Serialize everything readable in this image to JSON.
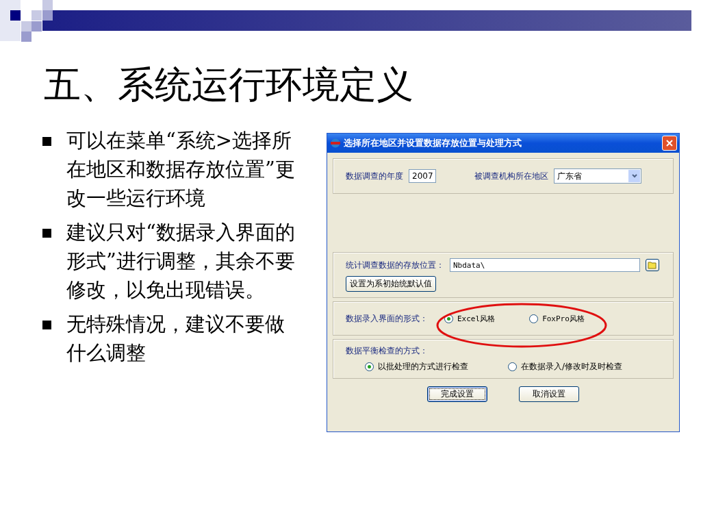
{
  "title": "五、系统运行环境定义",
  "bullets": [
    "可以在菜单“系统>选择所在地区和数据存放位置”更改一些运行环境",
    "建议只对“数据录入界面的形式”进行调整，其余不要修改，以免出现错误。",
    "无特殊情况，建议不要做什么调整"
  ],
  "dialog": {
    "title": "选择所在地区并设置数据存放位置与处理方式",
    "year_label": "数据调查的年度",
    "year": "2007",
    "region_label": "被调查机构所在地区",
    "region": "广东省",
    "storage_label": "统计调查数据的存放位置：",
    "storage_path": "Nbdata\\",
    "reset_button": "设置为系初始统默认值",
    "entry_form": {
      "label": "数据录入界面的形式：",
      "highlighted": true,
      "options": [
        {
          "label": "Excel风格",
          "selected": true
        },
        {
          "label": "FoxPro风格",
          "selected": false
        }
      ]
    },
    "balance_check": {
      "label": "数据平衡检查的方式：",
      "options": [
        {
          "label": "以批处理的方式进行检查",
          "selected": true
        },
        {
          "label": "在数据录入/修改时及时检查",
          "selected": false
        }
      ]
    },
    "buttons": [
      {
        "label": "完成设置",
        "focused": true
      },
      {
        "label": "取消设置",
        "focused": false
      }
    ]
  }
}
